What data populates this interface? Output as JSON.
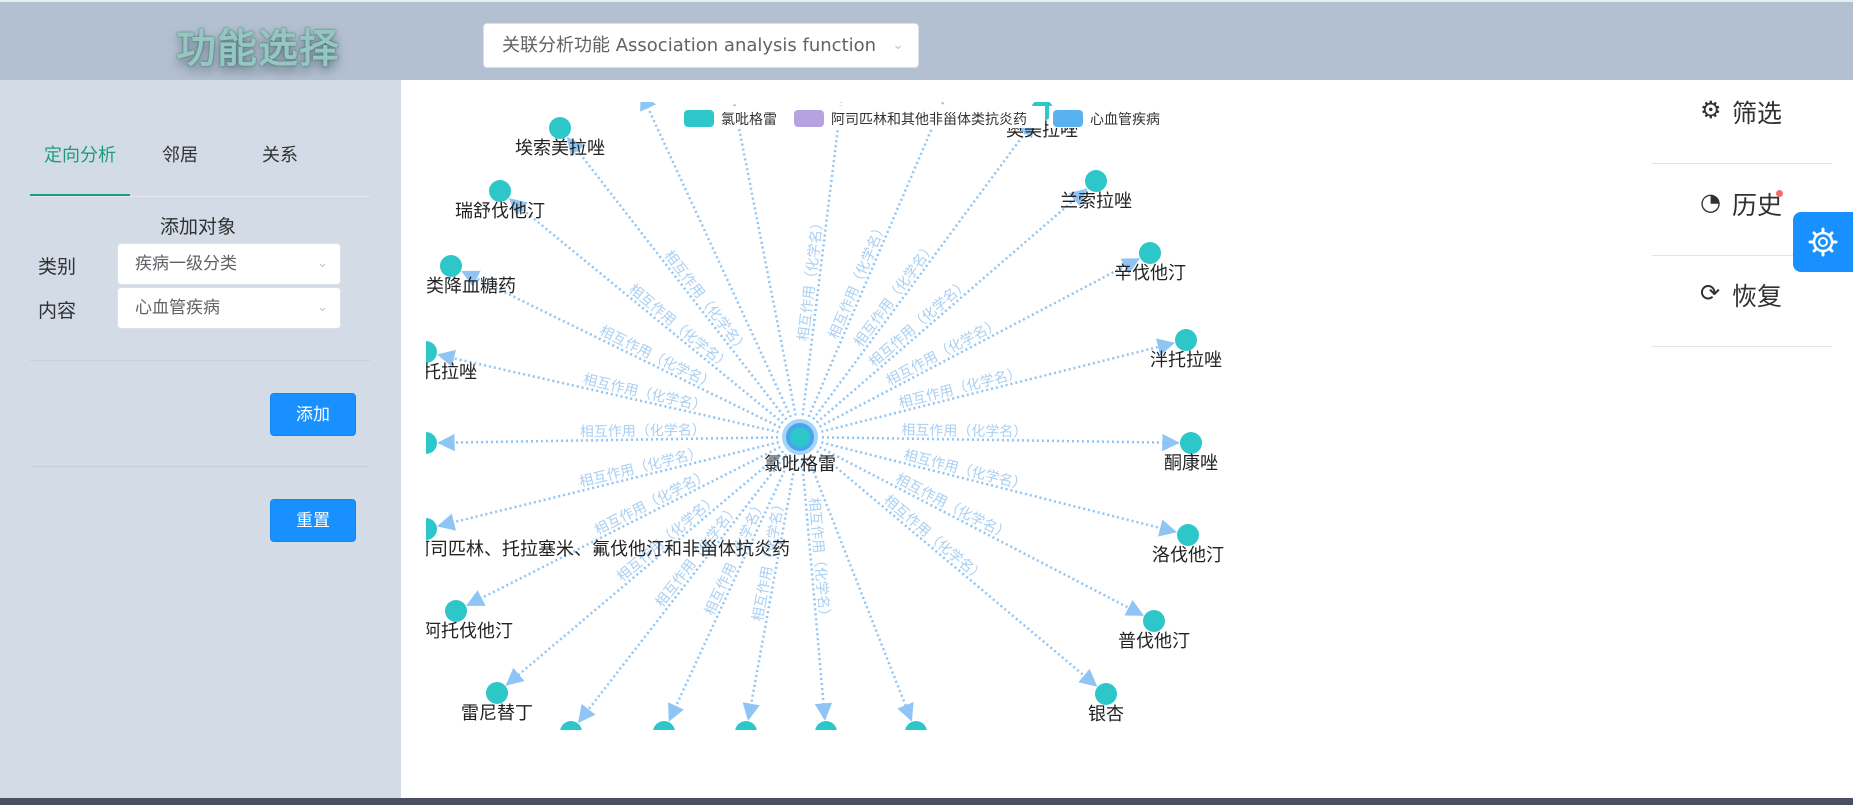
{
  "header": {
    "app_title": "功能选择",
    "function_select_value": "关联分析功能 Association analysis function"
  },
  "sidebar": {
    "tabs": [
      {
        "label": "定向分析",
        "active": true
      },
      {
        "label": "邻居",
        "active": false
      },
      {
        "label": "关系",
        "active": false
      }
    ],
    "add_title": "添加对象",
    "category_label": "类别",
    "category_value": "疾病一级分类",
    "content_label": "内容",
    "content_value": "心血管疾病",
    "add_button": "添加",
    "reset_button": "重置"
  },
  "graph": {
    "legend": [
      {
        "label": "氯吡格雷",
        "color": "#2ec7c9"
      },
      {
        "label": "阿司匹林和其他非甾体类抗炎药",
        "color": "#b6a2de"
      },
      {
        "label": "心血管疾病",
        "color": "#5ab1ef"
      }
    ],
    "center": {
      "label": "氯吡格雷",
      "color": "#2ec7c9"
    },
    "edge_label": "相互作用（化学名）",
    "nodes": [
      {
        "label": "埃索美拉唑"
      },
      {
        "label": "瑞舒伐他汀"
      },
      {
        "label": "类降血糖药"
      },
      {
        "label": "泮托拉唑"
      },
      {
        "label": ""
      },
      {
        "label": "阿司匹林、托拉塞米、氟伐他汀和非甾体抗炎药"
      },
      {
        "label": "阿托伐他汀"
      },
      {
        "label": "雷尼替丁"
      },
      {
        "label": ""
      },
      {
        "label": ""
      },
      {
        "label": ""
      },
      {
        "label": ""
      },
      {
        "label": ""
      },
      {
        "label": "银杏"
      },
      {
        "label": "普伐他汀"
      },
      {
        "label": "洛伐他汀"
      },
      {
        "label": "酮康唑"
      },
      {
        "label": "泮托拉唑"
      },
      {
        "label": "辛伐他汀"
      },
      {
        "label": "兰索拉唑"
      },
      {
        "label": "奥美拉唑"
      },
      {
        "label": ""
      },
      {
        "label": ""
      },
      {
        "label": ""
      },
      {
        "label": ""
      }
    ],
    "node_color": "#2ec7c9",
    "edge_color": "#8ec5f5"
  },
  "right_panel": {
    "filter": "筛选",
    "history": "历史",
    "restore": "恢复"
  }
}
